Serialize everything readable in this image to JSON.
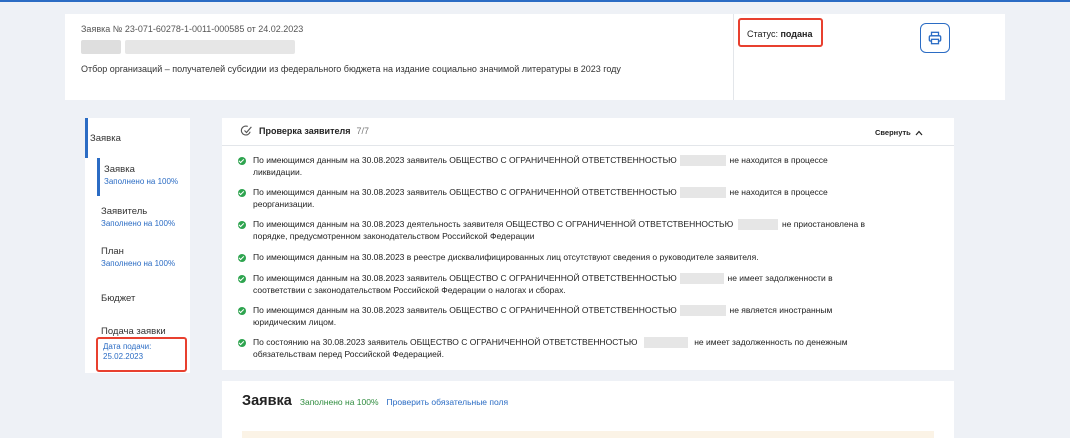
{
  "header": {
    "application_number": "Заявка № 23-071-60278-1-0011-000585 от 24.02.2023",
    "description": "Отбор организаций – получателей субсидии из федерального бюджета на издание социально значимой литературы в 2023 году",
    "status_label": "Статус:",
    "status_value": "подана",
    "print_icon": "printer-icon"
  },
  "sidebar": {
    "top_label": "Заявка",
    "items": [
      {
        "label": "Заявка",
        "sub": "Заполнено на 100%"
      },
      {
        "label": "Заявитель",
        "sub": "Заполнено на 100%"
      },
      {
        "label": "План",
        "sub": "Заполнено на 100%"
      },
      {
        "label": "Бюджет",
        "sub": ""
      },
      {
        "label": "Подача заявки",
        "sub": ""
      }
    ],
    "submit_date_label": "Дата подачи:",
    "submit_date_value": "25.02.2023"
  },
  "check": {
    "icon": "verify-icon",
    "title": "Проверка заявителя",
    "count": "7/7",
    "collapse_label": "Свернуть",
    "items": [
      {
        "before": "По имеющимся данным на 30.08.2023 заявитель ОБЩЕСТВО С ОГРАНИЧЕННОЙ ОТВЕТСТВЕННОСТЬЮ",
        "after": "не находится в процессе",
        "line2": "ликвидации."
      },
      {
        "before": "По имеющимся данным на 30.08.2023 заявитель ОБЩЕСТВО С ОГРАНИЧЕННОЙ ОТВЕТСТВЕННОСТЬЮ",
        "after": "не находится в процессе",
        "line2": "реорганизации."
      },
      {
        "before": "По имеющимся данным на 30.08.2023 деятельность заявителя ОБЩЕСТВО С ОГРАНИЧЕННОЙ ОТВЕТСТВЕННОСТЬЮ",
        "after": "не приостановлена в",
        "line2": "порядке, предусмотренном законодательством Российской Федерации"
      },
      {
        "before": "По имеющимся данным на 30.08.2023 в реестре дисквалифицированных лиц отсутствуют сведения о руководителе заявителя.",
        "after": "",
        "line2": ""
      },
      {
        "before": "По имеющимся данным на 30.08.2023 заявитель ОБЩЕСТВО С ОГРАНИЧЕННОЙ ОТВЕТСТВЕННОСТЬЮ",
        "after": "не имеет задолженности в",
        "line2": "соответствии с законодательством Российской Федерации о налогах и сборах."
      },
      {
        "before": "По имеющимся данным на 30.08.2023 заявитель ОБЩЕСТВО С ОГРАНИЧЕННОЙ ОТВЕТСТВЕННОСТЬЮ",
        "after": "не является иностранным",
        "line2": "юридическим лицом."
      },
      {
        "before": "По состоянию на 30.08.2023 заявитель ОБЩЕСТВО С ОГРАНИЧЕННОЙ ОТВЕТСТВЕННОСТЬЮ",
        "after": "не имеет задолженность по денежным",
        "line2": "обязательствам перед Российской Федерацией."
      }
    ]
  },
  "section": {
    "title": "Заявка",
    "filled": "Заполнено на 100%",
    "check_link": "Проверить обязательные поля"
  },
  "colors": {
    "accent": "#2b6cc4",
    "highlight": "#e8402f",
    "success": "#2ea44f"
  }
}
